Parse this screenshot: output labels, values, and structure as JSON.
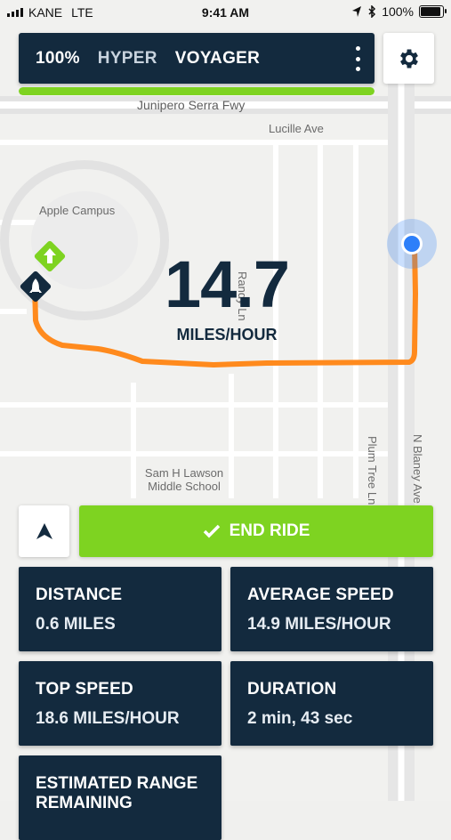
{
  "status_bar": {
    "carrier": "KANE",
    "network": "LTE",
    "time": "9:41 AM",
    "battery": "100%"
  },
  "top_bar": {
    "battery_pct": "100%",
    "mode": "HYPER",
    "vehicle": "VOYAGER",
    "battery_level": 1.0
  },
  "map": {
    "labels": {
      "freeway": "Junipero Serra Fwy",
      "lucille": "Lucille Ave",
      "apple": "Apple Campus",
      "randy": "Randy Ln",
      "school": "Sam H Lawson Middle School",
      "plum": "Plum Tree Ln",
      "blaney": "N Blaney Ave"
    },
    "route_color": "#ff8a1d",
    "current_location_color": "#2d7ff9"
  },
  "speed": {
    "value": "14.7",
    "unit": "MILES/HOUR"
  },
  "actions": {
    "end_ride": "END RIDE"
  },
  "stats": [
    {
      "title": "DISTANCE",
      "value": "0.6 MILES"
    },
    {
      "title": "AVERAGE SPEED",
      "value": "14.9 MILES/HOUR"
    },
    {
      "title": "TOP SPEED",
      "value": "18.6 MILES/HOUR"
    },
    {
      "title": "DURATION",
      "value": "2 min, 43 sec"
    },
    {
      "title": "ESTIMATED RANGE REMAINING",
      "value": ""
    }
  ],
  "colors": {
    "navy": "#132a3e",
    "green": "#7ed321",
    "orange": "#ff8a1d"
  }
}
